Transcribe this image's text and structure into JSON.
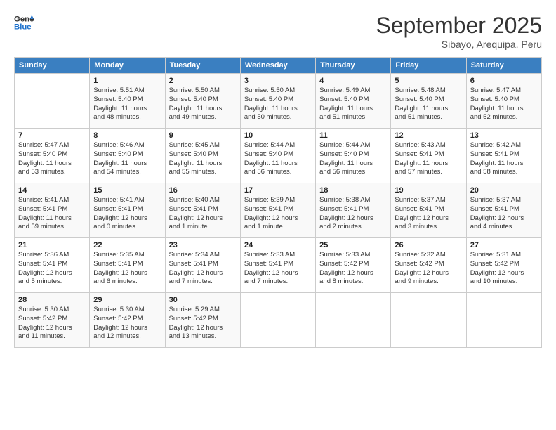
{
  "header": {
    "logo_line1": "General",
    "logo_line2": "Blue",
    "month": "September 2025",
    "location": "Sibayo, Arequipa, Peru"
  },
  "weekdays": [
    "Sunday",
    "Monday",
    "Tuesday",
    "Wednesday",
    "Thursday",
    "Friday",
    "Saturday"
  ],
  "weeks": [
    [
      {
        "day": "",
        "info": ""
      },
      {
        "day": "1",
        "info": "Sunrise: 5:51 AM\nSunset: 5:40 PM\nDaylight: 11 hours\nand 48 minutes."
      },
      {
        "day": "2",
        "info": "Sunrise: 5:50 AM\nSunset: 5:40 PM\nDaylight: 11 hours\nand 49 minutes."
      },
      {
        "day": "3",
        "info": "Sunrise: 5:50 AM\nSunset: 5:40 PM\nDaylight: 11 hours\nand 50 minutes."
      },
      {
        "day": "4",
        "info": "Sunrise: 5:49 AM\nSunset: 5:40 PM\nDaylight: 11 hours\nand 51 minutes."
      },
      {
        "day": "5",
        "info": "Sunrise: 5:48 AM\nSunset: 5:40 PM\nDaylight: 11 hours\nand 51 minutes."
      },
      {
        "day": "6",
        "info": "Sunrise: 5:47 AM\nSunset: 5:40 PM\nDaylight: 11 hours\nand 52 minutes."
      }
    ],
    [
      {
        "day": "7",
        "info": "Sunrise: 5:47 AM\nSunset: 5:40 PM\nDaylight: 11 hours\nand 53 minutes."
      },
      {
        "day": "8",
        "info": "Sunrise: 5:46 AM\nSunset: 5:40 PM\nDaylight: 11 hours\nand 54 minutes."
      },
      {
        "day": "9",
        "info": "Sunrise: 5:45 AM\nSunset: 5:40 PM\nDaylight: 11 hours\nand 55 minutes."
      },
      {
        "day": "10",
        "info": "Sunrise: 5:44 AM\nSunset: 5:40 PM\nDaylight: 11 hours\nand 56 minutes."
      },
      {
        "day": "11",
        "info": "Sunrise: 5:44 AM\nSunset: 5:40 PM\nDaylight: 11 hours\nand 56 minutes."
      },
      {
        "day": "12",
        "info": "Sunrise: 5:43 AM\nSunset: 5:41 PM\nDaylight: 11 hours\nand 57 minutes."
      },
      {
        "day": "13",
        "info": "Sunrise: 5:42 AM\nSunset: 5:41 PM\nDaylight: 11 hours\nand 58 minutes."
      }
    ],
    [
      {
        "day": "14",
        "info": "Sunrise: 5:41 AM\nSunset: 5:41 PM\nDaylight: 11 hours\nand 59 minutes."
      },
      {
        "day": "15",
        "info": "Sunrise: 5:41 AM\nSunset: 5:41 PM\nDaylight: 12 hours\nand 0 minutes."
      },
      {
        "day": "16",
        "info": "Sunrise: 5:40 AM\nSunset: 5:41 PM\nDaylight: 12 hours\nand 1 minute."
      },
      {
        "day": "17",
        "info": "Sunrise: 5:39 AM\nSunset: 5:41 PM\nDaylight: 12 hours\nand 1 minute."
      },
      {
        "day": "18",
        "info": "Sunrise: 5:38 AM\nSunset: 5:41 PM\nDaylight: 12 hours\nand 2 minutes."
      },
      {
        "day": "19",
        "info": "Sunrise: 5:37 AM\nSunset: 5:41 PM\nDaylight: 12 hours\nand 3 minutes."
      },
      {
        "day": "20",
        "info": "Sunrise: 5:37 AM\nSunset: 5:41 PM\nDaylight: 12 hours\nand 4 minutes."
      }
    ],
    [
      {
        "day": "21",
        "info": "Sunrise: 5:36 AM\nSunset: 5:41 PM\nDaylight: 12 hours\nand 5 minutes."
      },
      {
        "day": "22",
        "info": "Sunrise: 5:35 AM\nSunset: 5:41 PM\nDaylight: 12 hours\nand 6 minutes."
      },
      {
        "day": "23",
        "info": "Sunrise: 5:34 AM\nSunset: 5:41 PM\nDaylight: 12 hours\nand 7 minutes."
      },
      {
        "day": "24",
        "info": "Sunrise: 5:33 AM\nSunset: 5:41 PM\nDaylight: 12 hours\nand 7 minutes."
      },
      {
        "day": "25",
        "info": "Sunrise: 5:33 AM\nSunset: 5:42 PM\nDaylight: 12 hours\nand 8 minutes."
      },
      {
        "day": "26",
        "info": "Sunrise: 5:32 AM\nSunset: 5:42 PM\nDaylight: 12 hours\nand 9 minutes."
      },
      {
        "day": "27",
        "info": "Sunrise: 5:31 AM\nSunset: 5:42 PM\nDaylight: 12 hours\nand 10 minutes."
      }
    ],
    [
      {
        "day": "28",
        "info": "Sunrise: 5:30 AM\nSunset: 5:42 PM\nDaylight: 12 hours\nand 11 minutes."
      },
      {
        "day": "29",
        "info": "Sunrise: 5:30 AM\nSunset: 5:42 PM\nDaylight: 12 hours\nand 12 minutes."
      },
      {
        "day": "30",
        "info": "Sunrise: 5:29 AM\nSunset: 5:42 PM\nDaylight: 12 hours\nand 13 minutes."
      },
      {
        "day": "",
        "info": ""
      },
      {
        "day": "",
        "info": ""
      },
      {
        "day": "",
        "info": ""
      },
      {
        "day": "",
        "info": ""
      }
    ]
  ]
}
